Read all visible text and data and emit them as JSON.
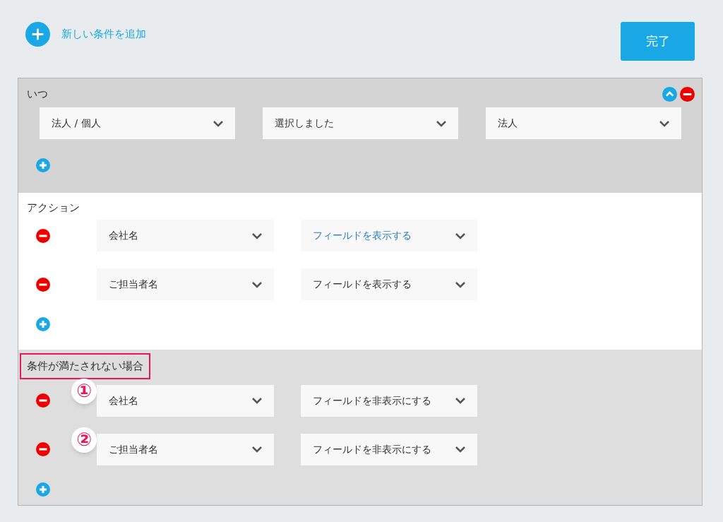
{
  "header": {
    "add_condition": "新しい条件を追加",
    "done_button": "完了"
  },
  "when": {
    "title": "いつ",
    "selects": [
      {
        "value": "法人 / 個人"
      },
      {
        "value": "選択しました"
      },
      {
        "value": "法人"
      }
    ]
  },
  "action": {
    "title": "アクション",
    "rows": [
      {
        "field": "会社名",
        "operation": "フィールドを表示する",
        "highlighted": true
      },
      {
        "field": "ご担当者名",
        "operation": "フィールドを表示する",
        "highlighted": false
      }
    ]
  },
  "otherwise": {
    "title": "条件が満たされない場合",
    "title_marked": true,
    "rows": [
      {
        "callout": "①",
        "field": "会社名",
        "operation": "フィールドを非表示にする",
        "highlighted": false
      },
      {
        "callout": "②",
        "field": "ご担当者名",
        "operation": "フィールドを非表示にする",
        "highlighted": false
      }
    ]
  }
}
